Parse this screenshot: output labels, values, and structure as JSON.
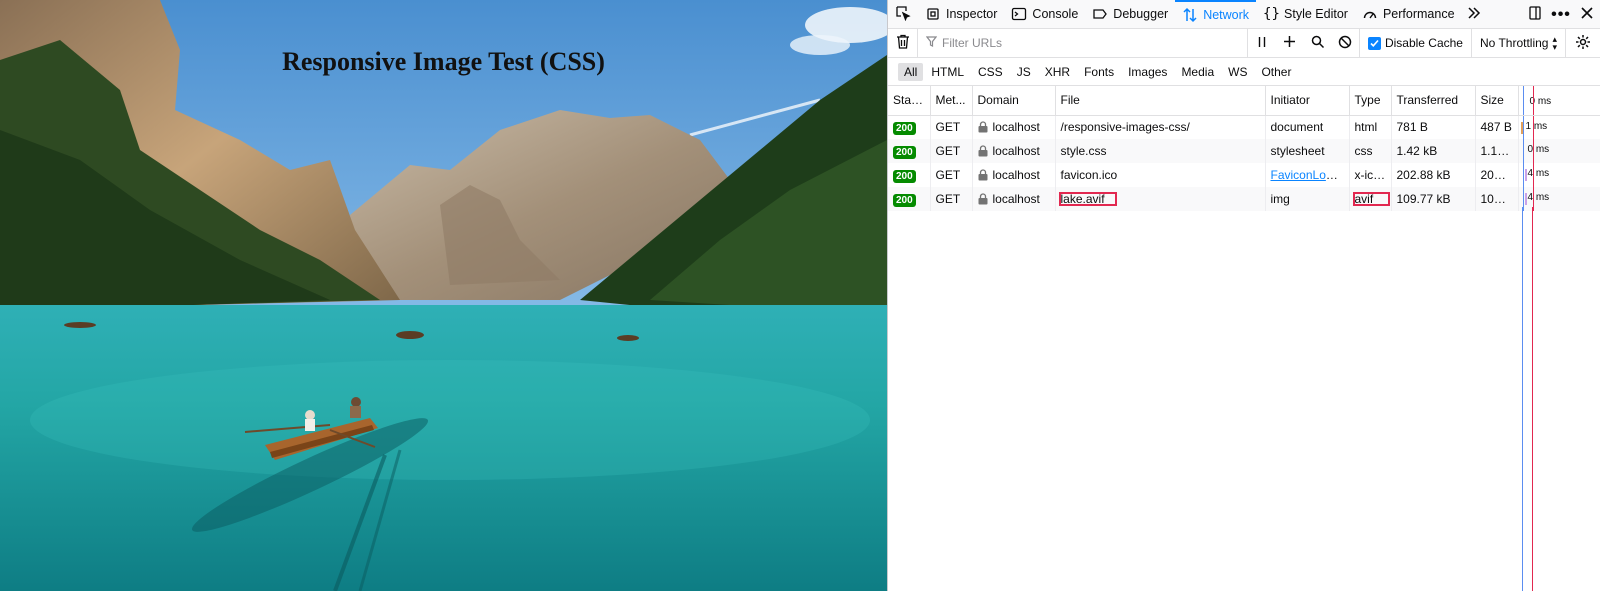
{
  "page": {
    "heading": "Responsive Image Test (CSS)"
  },
  "devtools": {
    "tabs": [
      {
        "label": "Inspector",
        "icon": "inspector-icon"
      },
      {
        "label": "Console",
        "icon": "console-icon"
      },
      {
        "label": "Debugger",
        "icon": "debugger-icon"
      },
      {
        "label": "Network",
        "icon": "network-icon",
        "active": true
      },
      {
        "label": "Style Editor",
        "icon": "style-editor-icon"
      },
      {
        "label": "Performance",
        "icon": "performance-icon"
      }
    ],
    "filter": {
      "placeholder": "Filter URLs"
    },
    "disable_cache_label": "Disable Cache",
    "disable_cache_checked": true,
    "throttling": "No Throttling",
    "type_filters": [
      "All",
      "HTML",
      "CSS",
      "JS",
      "XHR",
      "Fonts",
      "Images",
      "Media",
      "WS",
      "Other"
    ],
    "columns": [
      "Status",
      "Met...",
      "Domain",
      "File",
      "Initiator",
      "Type",
      "Transferred",
      "Size",
      "0 ms"
    ],
    "requests": [
      {
        "status": "200",
        "method": "GET",
        "domain": "localhost",
        "file": "/responsive-images-css/",
        "initiator": "document",
        "type": "html",
        "transferred": "781 B",
        "size": "487 B",
        "timing": "1 ms"
      },
      {
        "status": "200",
        "method": "GET",
        "domain": "localhost",
        "file": "style.css",
        "initiator": "stylesheet",
        "type": "css",
        "transferred": "1.42 kB",
        "size": "1.12 ...",
        "timing": "0 ms"
      },
      {
        "status": "200",
        "method": "GET",
        "domain": "localhost",
        "file": "favicon.ico",
        "initiator": "FaviconLoade...",
        "type": "x-icon",
        "transferred": "202.88 kB",
        "size": "202....",
        "timing": "4 ms"
      },
      {
        "status": "200",
        "method": "GET",
        "domain": "localhost",
        "file": "lake.avif",
        "initiator": "img",
        "type": "avif",
        "transferred": "109.77 kB",
        "size": "109....",
        "timing": "4 ms"
      }
    ],
    "colors": {
      "accent": "#0a84ff",
      "status_ok": "#058b00",
      "highlight": "#e22850"
    }
  }
}
